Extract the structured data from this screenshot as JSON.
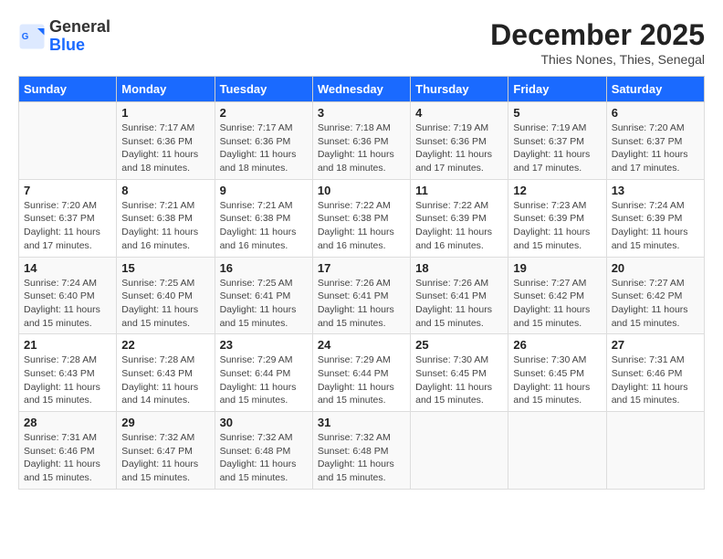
{
  "header": {
    "logo_general": "General",
    "logo_blue": "Blue",
    "month_title": "December 2025",
    "location": "Thies Nones, Thies, Senegal"
  },
  "weekdays": [
    "Sunday",
    "Monday",
    "Tuesday",
    "Wednesday",
    "Thursday",
    "Friday",
    "Saturday"
  ],
  "weeks": [
    [
      {
        "day": "",
        "info": ""
      },
      {
        "day": "1",
        "info": "Sunrise: 7:17 AM\nSunset: 6:36 PM\nDaylight: 11 hours and 18 minutes."
      },
      {
        "day": "2",
        "info": "Sunrise: 7:17 AM\nSunset: 6:36 PM\nDaylight: 11 hours and 18 minutes."
      },
      {
        "day": "3",
        "info": "Sunrise: 7:18 AM\nSunset: 6:36 PM\nDaylight: 11 hours and 18 minutes."
      },
      {
        "day": "4",
        "info": "Sunrise: 7:19 AM\nSunset: 6:36 PM\nDaylight: 11 hours and 17 minutes."
      },
      {
        "day": "5",
        "info": "Sunrise: 7:19 AM\nSunset: 6:37 PM\nDaylight: 11 hours and 17 minutes."
      },
      {
        "day": "6",
        "info": "Sunrise: 7:20 AM\nSunset: 6:37 PM\nDaylight: 11 hours and 17 minutes."
      }
    ],
    [
      {
        "day": "7",
        "info": "Sunrise: 7:20 AM\nSunset: 6:37 PM\nDaylight: 11 hours and 17 minutes."
      },
      {
        "day": "8",
        "info": "Sunrise: 7:21 AM\nSunset: 6:38 PM\nDaylight: 11 hours and 16 minutes."
      },
      {
        "day": "9",
        "info": "Sunrise: 7:21 AM\nSunset: 6:38 PM\nDaylight: 11 hours and 16 minutes."
      },
      {
        "day": "10",
        "info": "Sunrise: 7:22 AM\nSunset: 6:38 PM\nDaylight: 11 hours and 16 minutes."
      },
      {
        "day": "11",
        "info": "Sunrise: 7:22 AM\nSunset: 6:39 PM\nDaylight: 11 hours and 16 minutes."
      },
      {
        "day": "12",
        "info": "Sunrise: 7:23 AM\nSunset: 6:39 PM\nDaylight: 11 hours and 15 minutes."
      },
      {
        "day": "13",
        "info": "Sunrise: 7:24 AM\nSunset: 6:39 PM\nDaylight: 11 hours and 15 minutes."
      }
    ],
    [
      {
        "day": "14",
        "info": "Sunrise: 7:24 AM\nSunset: 6:40 PM\nDaylight: 11 hours and 15 minutes."
      },
      {
        "day": "15",
        "info": "Sunrise: 7:25 AM\nSunset: 6:40 PM\nDaylight: 11 hours and 15 minutes."
      },
      {
        "day": "16",
        "info": "Sunrise: 7:25 AM\nSunset: 6:41 PM\nDaylight: 11 hours and 15 minutes."
      },
      {
        "day": "17",
        "info": "Sunrise: 7:26 AM\nSunset: 6:41 PM\nDaylight: 11 hours and 15 minutes."
      },
      {
        "day": "18",
        "info": "Sunrise: 7:26 AM\nSunset: 6:41 PM\nDaylight: 11 hours and 15 minutes."
      },
      {
        "day": "19",
        "info": "Sunrise: 7:27 AM\nSunset: 6:42 PM\nDaylight: 11 hours and 15 minutes."
      },
      {
        "day": "20",
        "info": "Sunrise: 7:27 AM\nSunset: 6:42 PM\nDaylight: 11 hours and 15 minutes."
      }
    ],
    [
      {
        "day": "21",
        "info": "Sunrise: 7:28 AM\nSunset: 6:43 PM\nDaylight: 11 hours and 15 minutes."
      },
      {
        "day": "22",
        "info": "Sunrise: 7:28 AM\nSunset: 6:43 PM\nDaylight: 11 hours and 14 minutes."
      },
      {
        "day": "23",
        "info": "Sunrise: 7:29 AM\nSunset: 6:44 PM\nDaylight: 11 hours and 15 minutes."
      },
      {
        "day": "24",
        "info": "Sunrise: 7:29 AM\nSunset: 6:44 PM\nDaylight: 11 hours and 15 minutes."
      },
      {
        "day": "25",
        "info": "Sunrise: 7:30 AM\nSunset: 6:45 PM\nDaylight: 11 hours and 15 minutes."
      },
      {
        "day": "26",
        "info": "Sunrise: 7:30 AM\nSunset: 6:45 PM\nDaylight: 11 hours and 15 minutes."
      },
      {
        "day": "27",
        "info": "Sunrise: 7:31 AM\nSunset: 6:46 PM\nDaylight: 11 hours and 15 minutes."
      }
    ],
    [
      {
        "day": "28",
        "info": "Sunrise: 7:31 AM\nSunset: 6:46 PM\nDaylight: 11 hours and 15 minutes."
      },
      {
        "day": "29",
        "info": "Sunrise: 7:32 AM\nSunset: 6:47 PM\nDaylight: 11 hours and 15 minutes."
      },
      {
        "day": "30",
        "info": "Sunrise: 7:32 AM\nSunset: 6:48 PM\nDaylight: 11 hours and 15 minutes."
      },
      {
        "day": "31",
        "info": "Sunrise: 7:32 AM\nSunset: 6:48 PM\nDaylight: 11 hours and 15 minutes."
      },
      {
        "day": "",
        "info": ""
      },
      {
        "day": "",
        "info": ""
      },
      {
        "day": "",
        "info": ""
      }
    ]
  ]
}
